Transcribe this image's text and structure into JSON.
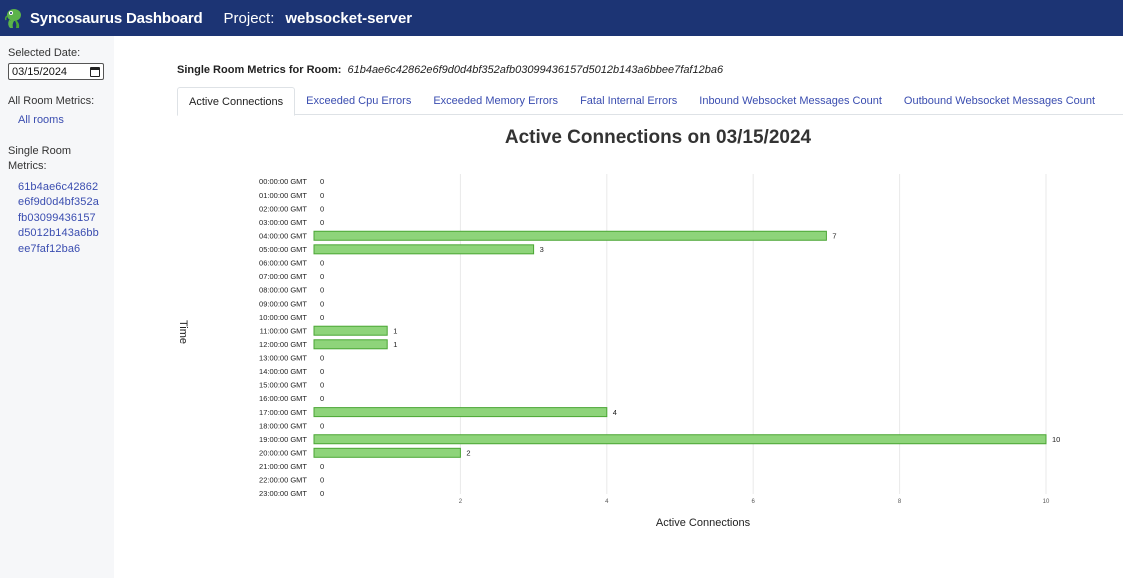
{
  "header": {
    "app_title": "Syncosaurus Dashboard",
    "project_label": "Project:",
    "project_name": "websocket-server",
    "logo_icon": "dinosaur-icon"
  },
  "sidebar": {
    "selected_date_label": "Selected Date:",
    "selected_date_value": "03/15/2024",
    "all_room_metrics_label": "All Room Metrics:",
    "all_rooms_link": "All rooms",
    "single_room_metrics_label": "Single Room Metrics:",
    "room_id_lines": [
      "61b4ae6c42862",
      "e6f9d0d4bf352a",
      "fb03099436157",
      "d5012b143a6bb",
      "ee7faf12ba6"
    ]
  },
  "main": {
    "room_header_label": "Single Room Metrics for Room:",
    "room_id": "61b4ae6c42862e6f9d0d4bf352afb03099436157d5012b143a6bbee7faf12ba6",
    "tabs": [
      {
        "label": "Active Connections",
        "active": true
      },
      {
        "label": "Exceeded Cpu Errors",
        "active": false
      },
      {
        "label": "Exceeded Memory Errors",
        "active": false
      },
      {
        "label": "Fatal Internal Errors",
        "active": false
      },
      {
        "label": "Inbound Websocket Messages Count",
        "active": false
      },
      {
        "label": "Outbound Websocket Messages Count",
        "active": false
      }
    ]
  },
  "chart_data": {
    "type": "bar",
    "orientation": "horizontal",
    "title": "Active Connections on 03/15/2024",
    "xlabel": "Active Connections",
    "ylabel": "Time",
    "categories": [
      "00:00:00 GMT",
      "01:00:00 GMT",
      "02:00:00 GMT",
      "03:00:00 GMT",
      "04:00:00 GMT",
      "05:00:00 GMT",
      "06:00:00 GMT",
      "07:00:00 GMT",
      "08:00:00 GMT",
      "09:00:00 GMT",
      "10:00:00 GMT",
      "11:00:00 GMT",
      "12:00:00 GMT",
      "13:00:00 GMT",
      "14:00:00 GMT",
      "15:00:00 GMT",
      "16:00:00 GMT",
      "17:00:00 GMT",
      "18:00:00 GMT",
      "19:00:00 GMT",
      "20:00:00 GMT",
      "21:00:00 GMT",
      "22:00:00 GMT",
      "23:00:00 GMT"
    ],
    "values": [
      0,
      0,
      0,
      0,
      7,
      3,
      0,
      0,
      0,
      0,
      0,
      1,
      1,
      0,
      0,
      0,
      0,
      4,
      0,
      10,
      2,
      0,
      0,
      0
    ],
    "xlim": [
      0,
      10
    ],
    "xticks": [
      2,
      4,
      6,
      8,
      10
    ],
    "grid": true,
    "colors": {
      "bar_fill": "#8ed47a",
      "bar_stroke": "#4aa634"
    }
  }
}
